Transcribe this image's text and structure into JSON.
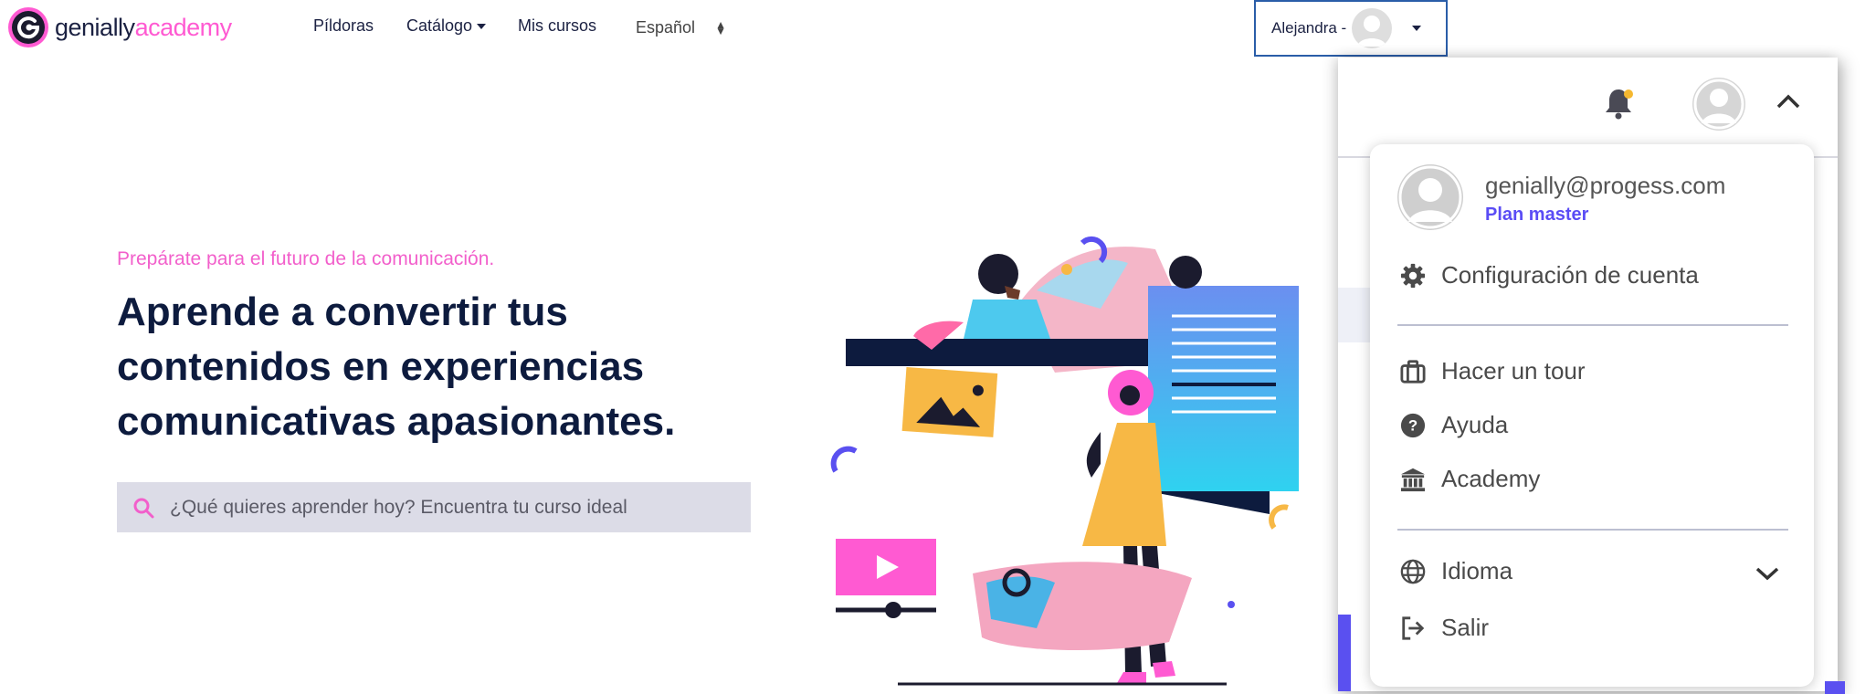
{
  "brand": {
    "name": "genially",
    "accent_word": "academy",
    "colors": {
      "pink": "#ff5ad2",
      "navy": "#0d1b3e",
      "purple": "#5a4cf5"
    }
  },
  "nav": {
    "items": [
      "Píldoras",
      "Catálogo",
      "Mis cursos"
    ],
    "language": "Español"
  },
  "user": {
    "name_label": "Alejandra -",
    "email": "genially@progess.com",
    "plan": "Plan master"
  },
  "hero": {
    "eyebrow": "Prepárate para el futuro de la comunicación.",
    "headline": "Aprende a convertir tus contenidos en experiencias comunicativas apasionantes.",
    "search_placeholder": "¿Qué quieres aprender hoy? Encuentra tu curso ideal"
  },
  "menu": {
    "items": [
      {
        "label": "Configuración de cuenta",
        "icon": "gear-icon"
      },
      {
        "label": "Hacer un tour",
        "icon": "luggage-icon"
      },
      {
        "label": "Ayuda",
        "icon": "question-circle-icon"
      },
      {
        "label": "Academy",
        "icon": "institution-icon"
      },
      {
        "label": "Idioma",
        "icon": "globe-icon"
      },
      {
        "label": "Salir",
        "icon": "sign-out-icon"
      }
    ]
  },
  "icons": {
    "search": "search-icon",
    "bell": "bell-icon",
    "notification_dot": "#f5b830"
  }
}
